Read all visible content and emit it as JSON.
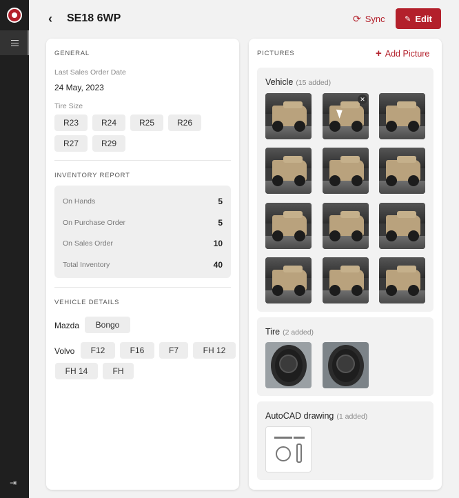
{
  "header": {
    "title": "SE18 6WP",
    "sync_label": "Sync",
    "edit_label": "Edit"
  },
  "general": {
    "heading": "GENERAL",
    "last_order_label": "Last Sales Order Date",
    "last_order_value": "24 May, 2023",
    "tire_size_label": "Tire Size",
    "tire_sizes": [
      "R23",
      "R24",
      "R25",
      "R26",
      "R27",
      "R29"
    ]
  },
  "inventory": {
    "heading": "INVENTORY REPORT",
    "rows": [
      {
        "label": "On Hands",
        "value": "5"
      },
      {
        "label": "On Purchase Order",
        "value": "5"
      },
      {
        "label": "On Sales Order",
        "value": "10"
      },
      {
        "label": "Total Inventory",
        "value": "40"
      }
    ]
  },
  "vehicle": {
    "heading": "VEHICLE DETAILS",
    "brands": [
      {
        "name": "Mazda",
        "models": [
          "Bongo"
        ]
      },
      {
        "name": "Volvo",
        "models": [
          "F12",
          "F16",
          "F7",
          "FH 12",
          "FH 14",
          "FH"
        ]
      }
    ]
  },
  "pictures": {
    "heading": "PICTURES",
    "add_label": "Add Picture",
    "groups": [
      {
        "title": "Vehicle",
        "count": "(15 added)"
      },
      {
        "title": "Tire",
        "count": "(2 added)"
      },
      {
        "title": "AutoCAD drawing",
        "count": "(1 added)"
      }
    ]
  },
  "icons": [
    "logo-icon",
    "list-icon",
    "logout-icon",
    "back-icon",
    "sync-icon",
    "edit-pencil-icon",
    "plus-icon",
    "close-icon"
  ],
  "colors": {
    "accent": "#b3202b",
    "sidebar": "#1f1f1f"
  }
}
